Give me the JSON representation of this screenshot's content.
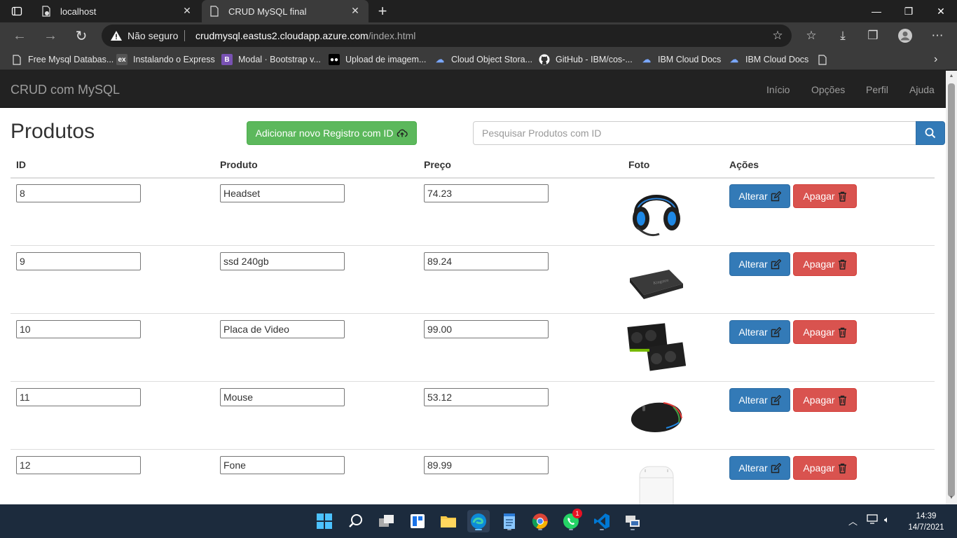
{
  "browser": {
    "tabs": [
      {
        "title": "localhost",
        "active": false
      },
      {
        "title": "CRUD MySQL final",
        "active": true
      }
    ],
    "security_label": "Não seguro",
    "url_host": "crudmysql.eastus2.cloudapp.azure.com",
    "url_path": "/index.html",
    "favorites": [
      {
        "label": "Free Mysql Databas...",
        "icon": "page-icon"
      },
      {
        "label": "Instalando o Express",
        "icon": "ex-icon"
      },
      {
        "label": "Modal · Bootstrap v...",
        "icon": "bootstrap-icon"
      },
      {
        "label": "Upload de imagem...",
        "icon": "medium-icon"
      },
      {
        "label": "Cloud Object Stora...",
        "icon": "ibm-cloud-icon"
      },
      {
        "label": "GitHub - IBM/cos-...",
        "icon": "github-icon"
      },
      {
        "label": "IBM Cloud Docs",
        "icon": "ibm-cloud-icon"
      },
      {
        "label": "IBM Cloud Docs",
        "icon": "ibm-cloud-icon"
      }
    ]
  },
  "navbar": {
    "brand": "CRUD com MySQL",
    "links": [
      "Início",
      "Opções",
      "Perfil",
      "Ajuda"
    ]
  },
  "main": {
    "title": "Produtos",
    "add_button_label": "Adicionar novo Registro com ID",
    "search_placeholder": "Pesquisar Produtos com ID"
  },
  "table": {
    "headers": [
      "ID",
      "Produto",
      "Preço",
      "Foto",
      "Ações"
    ],
    "rows": [
      {
        "id": "8",
        "produto": "Headset",
        "preco": "74.23",
        "foto": "headset-photo"
      },
      {
        "id": "9",
        "produto": "ssd 240gb",
        "preco": "89.24",
        "foto": "ssd-photo"
      },
      {
        "id": "10",
        "produto": "Placa de Video",
        "preco": "99.00",
        "foto": "gpu-photo"
      },
      {
        "id": "11",
        "produto": "Mouse",
        "preco": "53.12",
        "foto": "mouse-photo"
      },
      {
        "id": "12",
        "produto": "Fone",
        "preco": "89.99",
        "foto": "earbuds-photo"
      }
    ],
    "alter_label": "Alterar",
    "delete_label": "Apagar"
  },
  "taskbar": {
    "time": "14:39",
    "date": "14/7/2021",
    "whatsapp_badge": "1"
  },
  "colors": {
    "success": "#5cb85c",
    "primary": "#337ab7",
    "danger": "#d9534f",
    "navbar": "#222222"
  }
}
